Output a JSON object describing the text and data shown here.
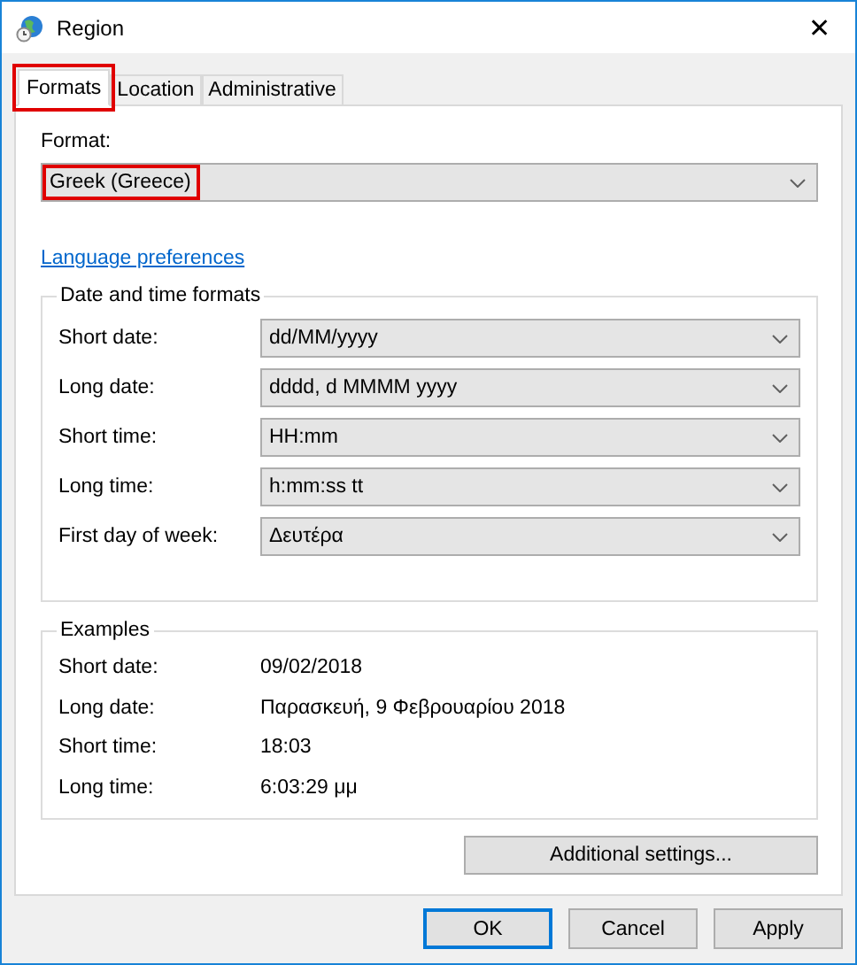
{
  "window": {
    "title": "Region",
    "close": "✕"
  },
  "tabs": [
    {
      "label": "Formats",
      "selected": true,
      "highlighted": true
    },
    {
      "label": "Location",
      "selected": false,
      "highlighted": false
    },
    {
      "label": "Administrative",
      "selected": false,
      "highlighted": false
    }
  ],
  "format": {
    "label": "Format:",
    "value": "Greek (Greece)",
    "highlighted": true
  },
  "language_link": "Language preferences",
  "date_time_formats": {
    "title": "Date and time formats",
    "rows": [
      {
        "label": "Short date:",
        "value": "dd/MM/yyyy"
      },
      {
        "label": "Long date:",
        "value": "dddd, d MMMM yyyy"
      },
      {
        "label": "Short time:",
        "value": "HH:mm"
      },
      {
        "label": "Long time:",
        "value": "h:mm:ss tt"
      },
      {
        "label": "First day of week:",
        "value": "Δευτέρα"
      }
    ]
  },
  "examples": {
    "title": "Examples",
    "rows": [
      {
        "label": "Short date:",
        "value": "09/02/2018"
      },
      {
        "label": "Long date:",
        "value": "Παρασκευή, 9 Φεβρουαρίου 2018"
      },
      {
        "label": "Short time:",
        "value": "18:03"
      },
      {
        "label": "Long time:",
        "value": "6:03:29 μμ"
      }
    ]
  },
  "additional_button": "Additional settings...",
  "buttons": [
    {
      "label": "OK",
      "default": true
    },
    {
      "label": "Cancel",
      "default": false
    },
    {
      "label": "Apply",
      "default": false
    }
  ]
}
